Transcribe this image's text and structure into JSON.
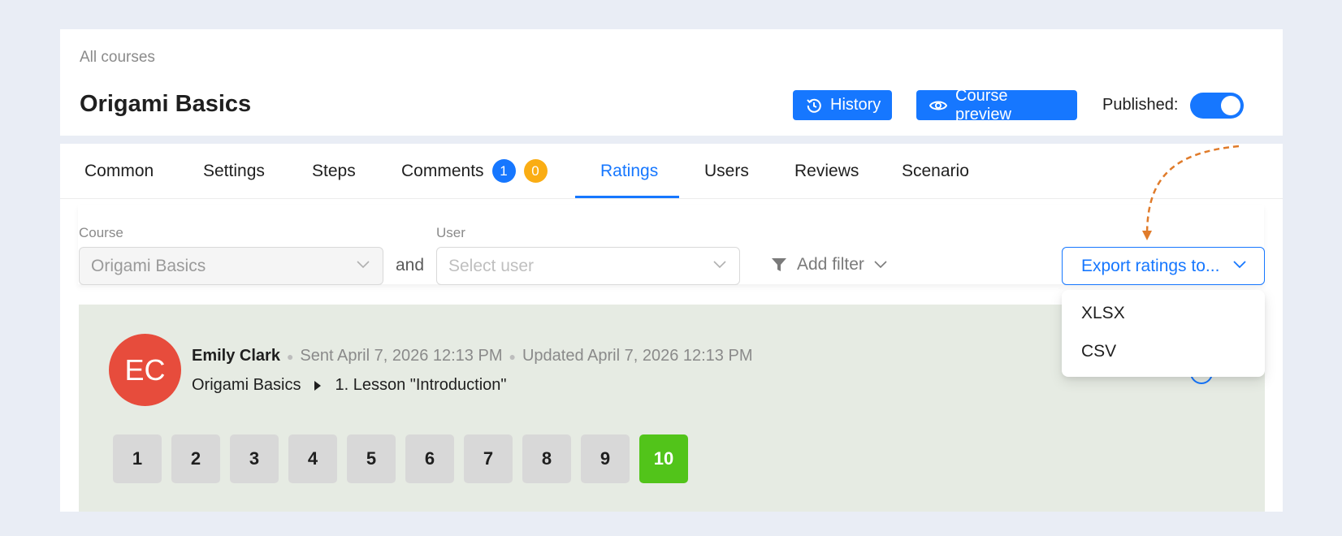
{
  "header": {
    "breadcrumb": "All courses",
    "title": "Origami Basics",
    "history_label": "History",
    "preview_label": "Course preview",
    "published_label": "Published:",
    "published": true
  },
  "tabs": [
    {
      "label": "Common"
    },
    {
      "label": "Settings"
    },
    {
      "label": "Steps"
    },
    {
      "label": "Comments",
      "badges": [
        "1",
        "0"
      ]
    },
    {
      "label": "Ratings",
      "active": true
    },
    {
      "label": "Users"
    },
    {
      "label": "Reviews"
    },
    {
      "label": "Scenario"
    }
  ],
  "filters": {
    "course_label": "Course",
    "course_value": "Origami Basics",
    "joiner": "and",
    "user_label": "User",
    "user_placeholder": "Select user",
    "add_filter_label": "Add filter",
    "export_label": "Export ratings to...",
    "export_options": [
      "XLSX",
      "CSV"
    ]
  },
  "rating": {
    "initials": "EC",
    "user_name": "Emily Clark",
    "sent": "Sent April 7, 2026 12:13 PM",
    "updated": "Updated April 7, 2026 12:13 PM",
    "course": "Origami Basics",
    "lesson": "1. Lesson \"Introduction\"",
    "scores": [
      "1",
      "2",
      "3",
      "4",
      "5",
      "6",
      "7",
      "8",
      "9",
      "10"
    ],
    "selected_score": "10"
  },
  "colors": {
    "primary": "#1677ff",
    "badge_blue": "#1677ff",
    "badge_orange": "#faad14",
    "avatar": "#e74c3c",
    "selected_score": "#52c41a",
    "annotation_arrow": "#e07b2a"
  }
}
